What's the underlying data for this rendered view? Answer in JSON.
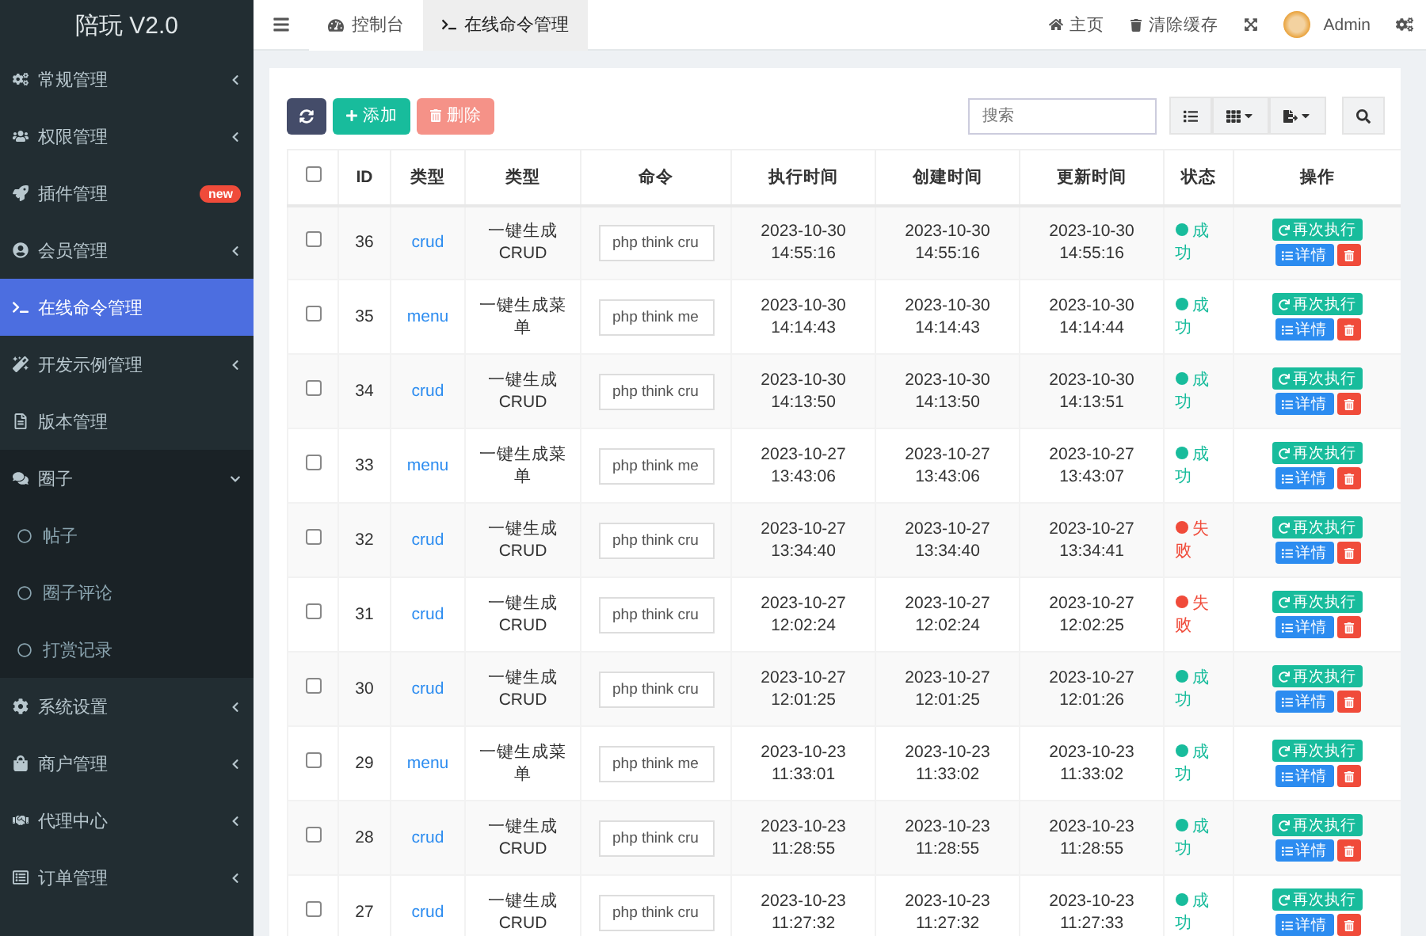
{
  "sidebar": {
    "title": "陪玩 V2.0",
    "items": [
      {
        "kind": "group",
        "label": "常规管理",
        "expanded": false,
        "selected": false
      },
      {
        "kind": "group",
        "label": "权限管理",
        "expanded": false,
        "selected": false
      },
      {
        "kind": "link",
        "label": "插件管理",
        "expanded": false,
        "selected": false,
        "badge": "new"
      },
      {
        "kind": "group",
        "label": "会员管理",
        "expanded": false,
        "selected": false
      },
      {
        "kind": "link",
        "label": "在线命令管理",
        "expanded": false,
        "selected": true
      },
      {
        "kind": "group",
        "label": "开发示例管理",
        "expanded": false,
        "selected": false
      },
      {
        "kind": "link",
        "label": "版本管理",
        "expanded": false,
        "selected": false
      },
      {
        "kind": "group",
        "label": "圈子",
        "expanded": true,
        "selected": false,
        "children": [
          {
            "label": "帖子",
            "selected": false
          },
          {
            "label": "圈子评论",
            "selected": false
          },
          {
            "label": "打赏记录",
            "selected": false
          }
        ]
      },
      {
        "kind": "group",
        "label": "系统设置",
        "expanded": false,
        "selected": false
      },
      {
        "kind": "group",
        "label": "商户管理",
        "expanded": false,
        "selected": false
      },
      {
        "kind": "group",
        "label": "代理中心",
        "expanded": false,
        "selected": false
      },
      {
        "kind": "group",
        "label": "订单管理",
        "expanded": false,
        "selected": false
      }
    ]
  },
  "tabs": [
    {
      "label": "控制台",
      "selected": false
    },
    {
      "label": "在线命令管理",
      "selected": true
    }
  ],
  "header_links": [
    {
      "label": "主页"
    },
    {
      "label": "清除缓存"
    }
  ],
  "user": {
    "name": "Admin"
  },
  "toolbar": {
    "add": {
      "label": "添加",
      "disabled": false
    },
    "delete": {
      "label": "删除",
      "disabled": true
    },
    "search": {
      "placeholder": "搜索"
    }
  },
  "table": {
    "select_all": false,
    "columns": [
      "ID",
      "类型",
      "类型",
      "命令",
      "执行时间",
      "创建时间",
      "更新时间",
      "状态",
      "操作"
    ],
    "rows": [
      {
        "checked": false,
        "id": "36",
        "type": "crud",
        "title": "一键生成CRUD",
        "command": "php think cru",
        "executed": "2023-10-30 14:55:16",
        "created": "2023-10-30 14:55:16",
        "updated": "2023-10-30 14:55:16",
        "status": {
          "text": "成功",
          "failed": false
        },
        "actions": {
          "rerun": "再次执行",
          "detail": "详情"
        }
      },
      {
        "checked": false,
        "id": "35",
        "type": "menu",
        "title": "一键生成菜单",
        "command": "php think me",
        "executed": "2023-10-30 14:14:43",
        "created": "2023-10-30 14:14:43",
        "updated": "2023-10-30 14:14:44",
        "status": {
          "text": "成功",
          "failed": false
        },
        "actions": {
          "rerun": "再次执行",
          "detail": "详情"
        }
      },
      {
        "checked": false,
        "id": "34",
        "type": "crud",
        "title": "一键生成CRUD",
        "command": "php think cru",
        "executed": "2023-10-30 14:13:50",
        "created": "2023-10-30 14:13:50",
        "updated": "2023-10-30 14:13:51",
        "status": {
          "text": "成功",
          "failed": false
        },
        "actions": {
          "rerun": "再次执行",
          "detail": "详情"
        }
      },
      {
        "checked": false,
        "id": "33",
        "type": "menu",
        "title": "一键生成菜单",
        "command": "php think me",
        "executed": "2023-10-27 13:43:06",
        "created": "2023-10-27 13:43:06",
        "updated": "2023-10-27 13:43:07",
        "status": {
          "text": "成功",
          "failed": false
        },
        "actions": {
          "rerun": "再次执行",
          "detail": "详情"
        }
      },
      {
        "checked": false,
        "id": "32",
        "type": "crud",
        "title": "一键生成CRUD",
        "command": "php think cru",
        "executed": "2023-10-27 13:34:40",
        "created": "2023-10-27 13:34:40",
        "updated": "2023-10-27 13:34:41",
        "status": {
          "text": "失败",
          "failed": true
        },
        "actions": {
          "rerun": "再次执行",
          "detail": "详情"
        }
      },
      {
        "checked": false,
        "id": "31",
        "type": "crud",
        "title": "一键生成CRUD",
        "command": "php think cru",
        "executed": "2023-10-27 12:02:24",
        "created": "2023-10-27 12:02:24",
        "updated": "2023-10-27 12:02:25",
        "status": {
          "text": "失败",
          "failed": true
        },
        "actions": {
          "rerun": "再次执行",
          "detail": "详情"
        }
      },
      {
        "checked": false,
        "id": "30",
        "type": "crud",
        "title": "一键生成CRUD",
        "command": "php think cru",
        "executed": "2023-10-27 12:01:25",
        "created": "2023-10-27 12:01:25",
        "updated": "2023-10-27 12:01:26",
        "status": {
          "text": "成功",
          "failed": false
        },
        "actions": {
          "rerun": "再次执行",
          "detail": "详情"
        }
      },
      {
        "checked": false,
        "id": "29",
        "type": "menu",
        "title": "一键生成菜单",
        "command": "php think me",
        "executed": "2023-10-23 11:33:01",
        "created": "2023-10-23 11:33:02",
        "updated": "2023-10-23 11:33:02",
        "status": {
          "text": "成功",
          "failed": false
        },
        "actions": {
          "rerun": "再次执行",
          "detail": "详情"
        }
      },
      {
        "checked": false,
        "id": "28",
        "type": "crud",
        "title": "一键生成CRUD",
        "command": "php think cru",
        "executed": "2023-10-23 11:28:55",
        "created": "2023-10-23 11:28:55",
        "updated": "2023-10-23 11:28:55",
        "status": {
          "text": "成功",
          "failed": false
        },
        "actions": {
          "rerun": "再次执行",
          "detail": "详情"
        }
      },
      {
        "checked": false,
        "id": "27",
        "type": "crud",
        "title": "一键生成CRUD",
        "command": "php think cru",
        "executed": "2023-10-23 11:27:32",
        "created": "2023-10-23 11:27:32",
        "updated": "2023-10-23 11:27:33",
        "status": {
          "text": "成功",
          "failed": false
        },
        "actions": {
          "rerun": "再次执行",
          "detail": "详情"
        }
      }
    ]
  }
}
